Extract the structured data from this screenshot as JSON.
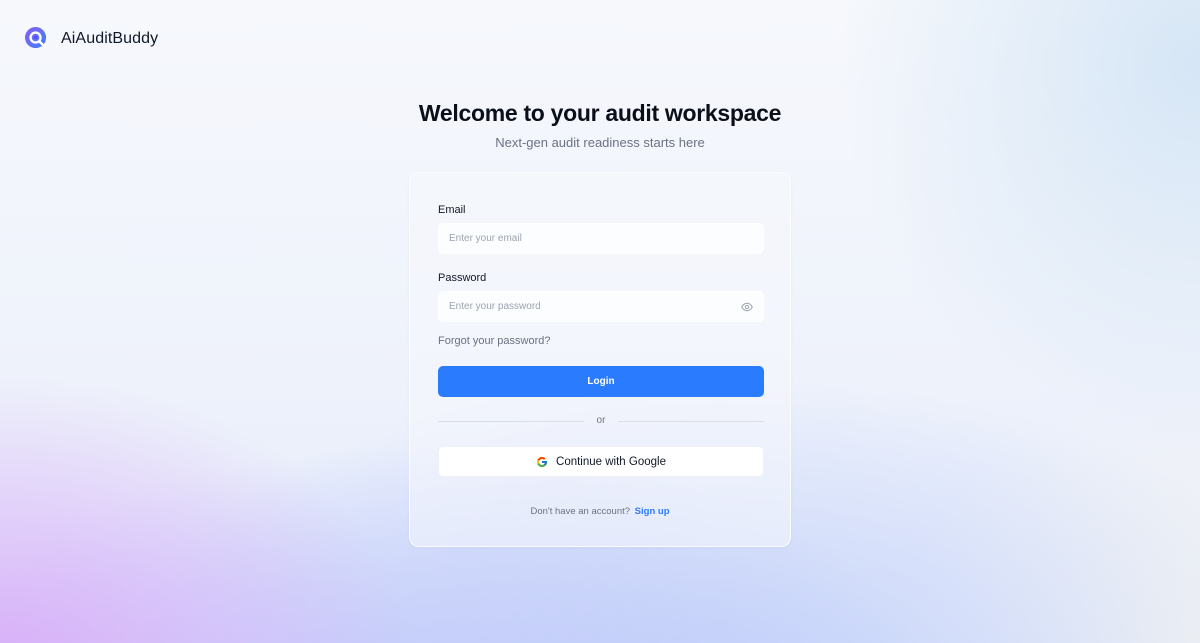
{
  "brand": {
    "name": "AiAuditBuddy",
    "logo_icon": "magnifier-logo-icon",
    "colors": {
      "gradient_start": "#7c3aed",
      "gradient_end": "#2563eb"
    }
  },
  "header": {
    "title": "Welcome to your audit workspace",
    "subtitle": "Next-gen audit readiness starts here"
  },
  "form": {
    "email": {
      "label": "Email",
      "value": "",
      "placeholder": "Enter your email"
    },
    "password": {
      "label": "Password",
      "value": "",
      "placeholder": "Enter your password",
      "toggle_icon": "eye-icon"
    },
    "forgot_label": "Forgot your password?",
    "login_label": "Login",
    "divider_label": "or",
    "google_label": "Continue with Google",
    "google_icon": "google-icon",
    "signup_prompt": "Don't have an account?",
    "signup_label": "Sign up"
  },
  "colors": {
    "accent": "#2b7bff",
    "muted_text": "#6b7280",
    "title_text": "#0b0f19"
  }
}
